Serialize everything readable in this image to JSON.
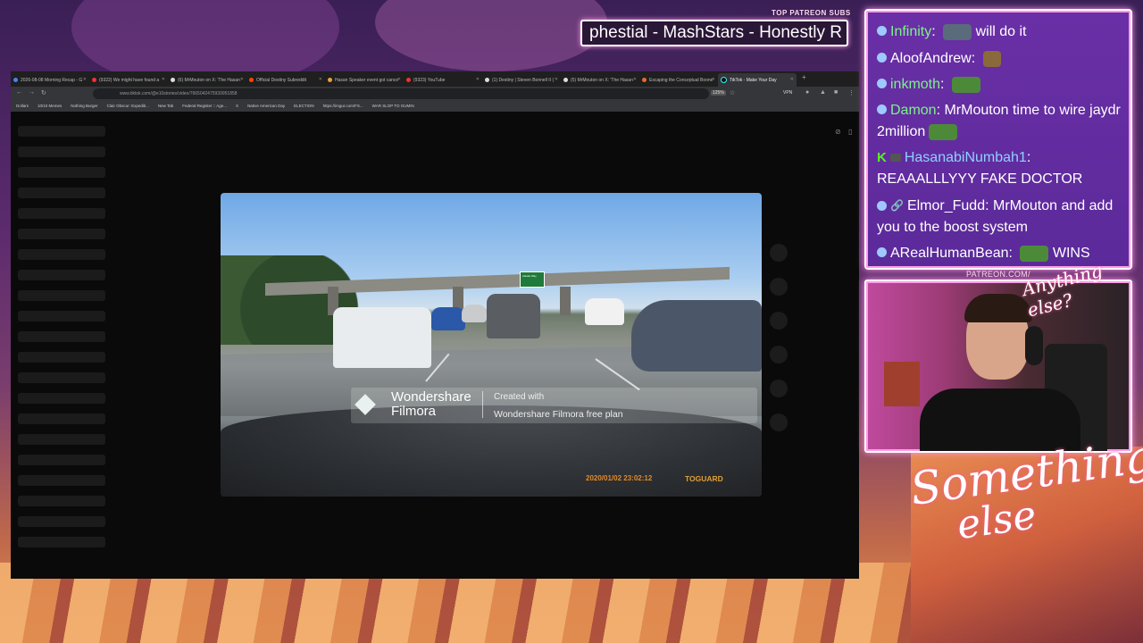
{
  "overlay": {
    "subs_title": "TOP PATREON SUBS",
    "subs_ticker": "phestial - MashStars - Honestly R",
    "patreon_url": "PATREON.COM/",
    "logo_small": "Anything else?",
    "logo_big_line1": "Something",
    "logo_big_line2": "else"
  },
  "browser": {
    "tabs": [
      {
        "label": "2026-08-08 Morning Recap - G",
        "active": false
      },
      {
        "label": "(9322) We might have found a",
        "active": false
      },
      {
        "label": "(6) MrMouton on X: 'The Hasan",
        "active": false
      },
      {
        "label": "Official Destiny Subreddit",
        "active": false
      },
      {
        "label": "Hasan Speaker event got cance",
        "active": false
      },
      {
        "label": "(9323) YouTube",
        "active": false
      },
      {
        "label": "(1) Destiny | Steven Bonnell II (",
        "active": false
      },
      {
        "label": "(5) MrMouton on X: 'The Hasan",
        "active": false
      },
      {
        "label": "Escaping the Conceptual Boone",
        "active": false
      },
      {
        "label": "TikTok - Make Your Day",
        "active": true
      }
    ],
    "address": "www.tiktok.com/@e10stories/video/7665042475939951858",
    "zoom": "125%",
    "vpn": "VPN",
    "bookmarks": [
      "Dollars",
      "10/10 Memes",
      "Nothing Burger",
      "Clair Obscur: Expediti...",
      "New Tab",
      "Federal Register :: Age...",
      "X",
      "Native American Day",
      "ELECTION",
      "https://imgur.com/FS...",
      "WAR SLOP TO GUMIN"
    ]
  },
  "video": {
    "watermark_brand_line1": "Wondershare",
    "watermark_brand_line2": "Filmora",
    "watermark_created": "Created with",
    "watermark_plan": "Wondershare Filmora free plan",
    "timestamp": "2020/01/02 23:02:12",
    "camera_brand": "TOGUARD",
    "road_sign": "Alaska Way"
  },
  "chat": {
    "messages": [
      {
        "user": "Infinity",
        "sep": ": ",
        "text": "will do it",
        "color": "#7cf28a"
      },
      {
        "user": "AloofAndrew",
        "sep": ": ",
        "text": "",
        "color": "#ffffff"
      },
      {
        "user": "inkmoth",
        "sep": ": ",
        "text": "",
        "color": "#7cf28a"
      },
      {
        "user": "Damon",
        "sep": ": ",
        "text": "MrMouton time to wire jaydr 2million",
        "color": "#7cf28a"
      },
      {
        "user": "HasanabiNumbah1",
        "sep": ":",
        "text": "REAAALLLYYY FAKE DOCTOR",
        "color": "#8fd0ff"
      },
      {
        "user": "Elmor_Fudd",
        "sep": ": ",
        "text": "MrMouton and add you to the boost system",
        "color": "#ffffff"
      },
      {
        "user": "ARealHumanBean",
        "sep": ": ",
        "text": "WINS",
        "color": "#ffffff"
      }
    ]
  },
  "colors": {
    "accent_pink": "#ff9be9",
    "chat_bg": "#5b2a9a",
    "name_green": "#7cf28a",
    "name_blue": "#8fd0ff",
    "timestamp_orange": "#e28a2a"
  }
}
